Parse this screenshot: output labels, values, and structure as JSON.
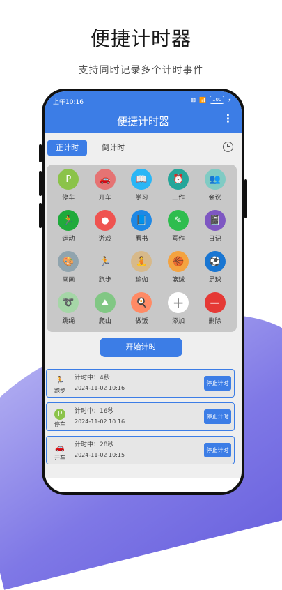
{
  "promo": {
    "title": "便捷计时器",
    "subtitle": "支持同时记录多个计时事件"
  },
  "status_bar": {
    "time": "上午10:16",
    "battery": "100"
  },
  "app_bar": {
    "title": "便捷计时器"
  },
  "tabs": {
    "count_up": "正计时",
    "count_down": "倒计时"
  },
  "activities": [
    {
      "label": "停车",
      "icon": "parking-icon",
      "color": "#8bc34a",
      "glyph": "P"
    },
    {
      "label": "开车",
      "icon": "car-icon",
      "color": "#e57373",
      "glyph": "🚗"
    },
    {
      "label": "学习",
      "icon": "book-study-icon",
      "color": "#29b6f6",
      "glyph": "📖"
    },
    {
      "label": "工作",
      "icon": "work-clock-icon",
      "color": "#26a69a",
      "glyph": "⏰"
    },
    {
      "label": "会议",
      "icon": "meeting-icon",
      "color": "#80cbc4",
      "glyph": "👥"
    },
    {
      "label": "运动",
      "icon": "exercise-icon",
      "color": "#1faa3b",
      "glyph": "🏃"
    },
    {
      "label": "游戏",
      "icon": "game-icon",
      "color": "#ef5350",
      "glyph": "●"
    },
    {
      "label": "看书",
      "icon": "reading-icon",
      "color": "#1e88e5",
      "glyph": "📘"
    },
    {
      "label": "写作",
      "icon": "writing-icon",
      "color": "#2ebd4e",
      "glyph": "✎"
    },
    {
      "label": "日记",
      "icon": "diary-icon",
      "color": "#7e57c2",
      "glyph": "📓"
    },
    {
      "label": "画画",
      "icon": "painting-icon",
      "color": "#90a4ae",
      "glyph": "🎨"
    },
    {
      "label": "跑步",
      "icon": "running-icon",
      "color": "#c8c8c8",
      "glyph": "🏃"
    },
    {
      "label": "瑜伽",
      "icon": "yoga-icon",
      "color": "#d7b98a",
      "glyph": "🧘"
    },
    {
      "label": "篮球",
      "icon": "basketball-icon",
      "color": "#f4a340",
      "glyph": "🏀"
    },
    {
      "label": "足球",
      "icon": "football-icon",
      "color": "#1976d2",
      "glyph": "⚽"
    },
    {
      "label": "跳绳",
      "icon": "jump-rope-icon",
      "color": "#a5d6a7",
      "glyph": "➰"
    },
    {
      "label": "爬山",
      "icon": "mountain-icon",
      "color": "#81c784",
      "glyph": "⛰"
    },
    {
      "label": "做饭",
      "icon": "cooking-icon",
      "color": "#ff8a65",
      "glyph": "🍳"
    },
    {
      "label": "添加",
      "icon": "add-icon",
      "color": "#ffffff",
      "glyph": "+"
    },
    {
      "label": "删除",
      "icon": "delete-icon",
      "color": "#e53935",
      "glyph": "−"
    }
  ],
  "start_button": "开始计时",
  "records": [
    {
      "activity": "跑步",
      "icon": "running-icon",
      "elapsed": "计时中：4秒",
      "time": "2024-11-02 10:16",
      "stop_label": "停止计时"
    },
    {
      "activity": "停车",
      "icon": "parking-icon",
      "elapsed": "计时中：16秒",
      "time": "2024-11-02 10:16",
      "stop_label": "停止计时"
    },
    {
      "activity": "开车",
      "icon": "car-icon",
      "elapsed": "计时中：28秒",
      "time": "2024-11-02 10:15",
      "stop_label": "停止计时"
    }
  ]
}
